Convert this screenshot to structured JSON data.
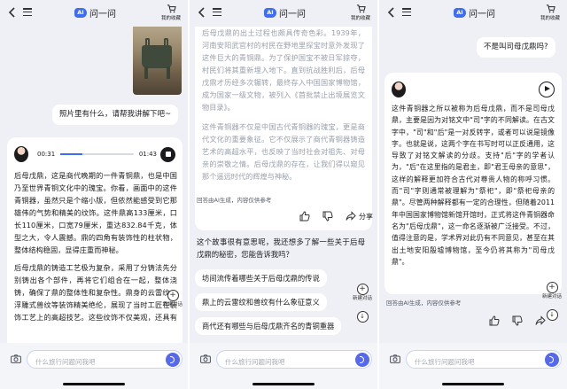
{
  "header": {
    "brand_logo": "AI",
    "brand_name": "问一问",
    "favorites_label": "我的收藏",
    "accent": "#3d6df5"
  },
  "screen1": {
    "user_message": "照片里有什么，请帮我讲解下吧~",
    "audio": {
      "current_time": "00:31",
      "total_time": "01:43",
      "progress": 0.3
    },
    "answer_paragraphs": [
      "后母戊鼎，这是商代晚期的一件青铜鼎，也是中国乃至世界青铜文化中的瑰宝。你看，画面中的这件青铜器，虽然只是个缩小版，但依然能感受到它那雄伟的气势和精美的纹饰。这件鼎高133厘米，口长110厘米，口宽79厘米，重达832.84千克，体型之大，令人震撼。鼎的四角有装饰性的柱状物，整体结构稳固，显得庄重而神秘。",
      "后母戊鼎的铸造工艺极为复杂，采用了分铸法先分别铸出各个部件，再将它们组合在一起，整体浇铸，确保了鼎的整体性和复杂性。鼎身的云雷纹、浮雕式兽纹等装饰精美绝伦，展现了当时工匠在装饰工艺上的高超技艺。这些纹饰不仅美观，还具有深刻的文化寓意，反映了商代的审美观念"
    ],
    "new_chat_label": "新建对话"
  },
  "screen2": {
    "answer_paragraphs": [
      "后母戊鼎的出土过程也颇具传奇色彩。1939年，河南安阳武官村的村民在野地里探宝时意外发现了这件巨大的青铜鼎。为了保护国宝不被日军掠夺，村民们将其重新埋入地下。直到抗战胜利后，后母戊鼎才历经多次辗转，最终存入中国国家博物馆，成为国家一级文物，被列入《首批禁止出境展览文物目录》。",
      "这件青铜器不仅是中国古代青铜器的瑰宝，更是商代文化的重要象征。它不仅展示了商代青铜器铸造艺术的高超水平，也反映了当时社会对祖先、对母亲的崇敬之情。后母戊鼎的存在，让我们得以窥见那个遥远时代的辉煌与神秘。"
    ],
    "disclaimer": "回答由AI生成，内容仅供参考",
    "share_label": "分享",
    "followup_question": "这个故事很有意思呢，我还想多了解一些关于后母戊鼎的秘密，您能告诉我吗？",
    "suggestions": [
      "坊间流传着哪些关于后母戊鼎的传说",
      "鼎上的云雷纹和兽纹有什么象征意义",
      "商代还有哪些与后母戊鼎齐名的青铜重器"
    ],
    "new_chat_label": "新建对话"
  },
  "screen3": {
    "user_message": "不是叫司母戊鼎吗?",
    "answer_paragraphs": [
      "这件青铜器之所以被称为后母戊鼎，而不是司母戊鼎，主要是因为对铭文中\"司\"字的不同解读。在古文字中，\"司\"和\"后\"是一对反转字，或者可以说是镜像字。也就是说，这两个字在书写时可以正反通用，这导致了对铭文解读的分歧。支持\"后\"字的学者认为，\"后\"在这里指的是君主，即\"君王母亲的意思\"，这样的解释更加符合古代对尊贵人物的称呼习惯。而\"司\"字则通常被理解为\"祭祀\"，即\"祭祀母亲的鼎\"。尽管两种解释都有一定的合理性，但随着2011年中国国家博物馆新馆开馆时，正式将这件青铜器命名为\"后母戊鼎\"，这一命名逐渐被广泛接受。不过，值得注意的是，学术界对此仍有不同意见，甚至在其出土地安阳殷墟博物馆，至今仍将其称为\"司母戊鼎\"。"
    ],
    "disclaimer": "回答由AI生成，内容仅供参考",
    "new_chat_label": "新建对话"
  },
  "input": {
    "placeholder": "什么旅行问题问我吧"
  }
}
